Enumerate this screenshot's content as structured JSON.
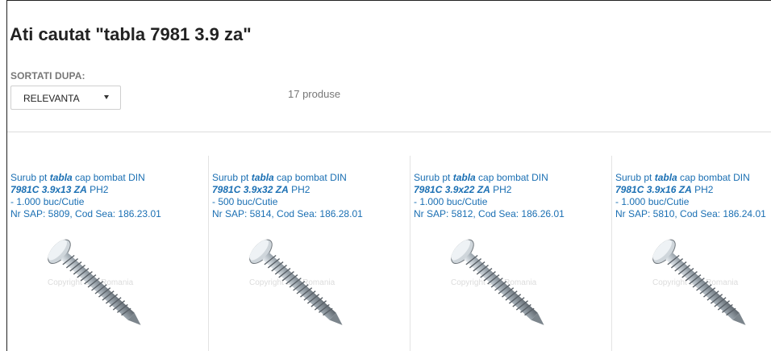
{
  "search": {
    "title": "Ati cautat \"tabla 7981 3.9 za\""
  },
  "sort": {
    "label": "SORTATI DUPA:",
    "selected": "RELEVANTA"
  },
  "results": {
    "count_text": "17 produse"
  },
  "products": [
    {
      "prefix": "Surub pt ",
      "keyword": "tabla",
      "suffix": " cap bombat DIN",
      "code": "7981C 3.9x13 ZA",
      "type": " PH2",
      "package": "- 1.000 buc/Cutie",
      "sap": "Nr SAP: 5809, Cod Sea: 186.23.01",
      "image_icon": "screw-icon",
      "watermark": "Copyright Sea Romania"
    },
    {
      "prefix": "Surub pt ",
      "keyword": "tabla",
      "suffix": " cap bombat DIN",
      "code": "7981C 3.9x32 ZA",
      "type": " PH2",
      "package": "- 500 buc/Cutie",
      "sap": "Nr SAP: 5814, Cod Sea: 186.28.01",
      "image_icon": "screw-icon",
      "watermark": "Copyright Sea Romania"
    },
    {
      "prefix": "Surub pt ",
      "keyword": "tabla",
      "suffix": " cap bombat DIN",
      "code": "7981C 3.9x22 ZA",
      "type": " PH2",
      "package": "- 1.000 buc/Cutie",
      "sap": "Nr SAP: 5812, Cod Sea: 186.26.01",
      "image_icon": "screw-icon",
      "watermark": "Copyright Sea Romania"
    },
    {
      "prefix": "Surub pt ",
      "keyword": "tabla",
      "suffix": " cap bombat DIN",
      "code": "7981C 3.9x16 ZA",
      "type": " PH2",
      "package": "- 1.000 buc/Cutie",
      "sap": "Nr SAP: 5810, Cod Sea: 186.24.01",
      "image_icon": "screw-icon",
      "watermark": "Copyright Sea Romania"
    }
  ],
  "colors": {
    "link": "#1a6fb3",
    "title": "#222222",
    "muted": "#777777"
  }
}
